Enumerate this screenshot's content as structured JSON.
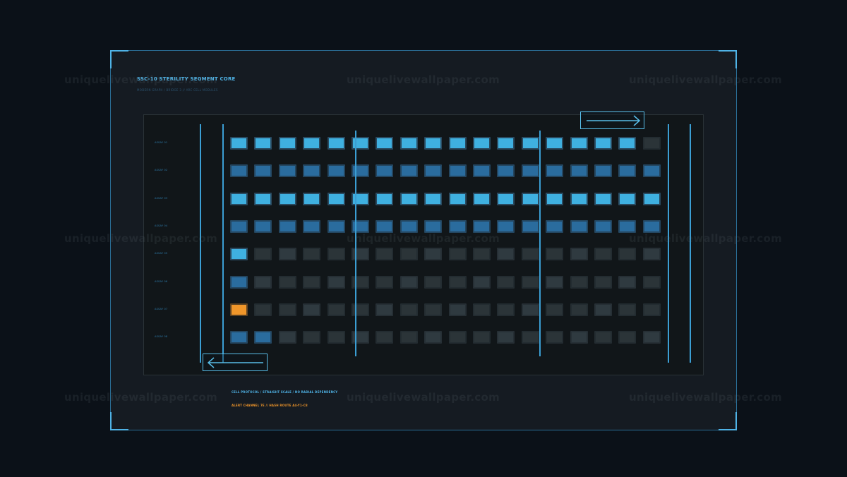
{
  "header": {
    "title": "SSC-10  STERILITY SEGMENT CORE",
    "subtitle": "MODERN GRAPH / BRIDGE 3  //  ARC CELL MODULES"
  },
  "rows": [
    {
      "label": "ASSAY 01",
      "states": [
        "bright",
        "bright",
        "bright",
        "bright",
        "bright",
        "bright",
        "bright",
        "bright",
        "bright",
        "bright",
        "bright",
        "bright",
        "bright",
        "bright",
        "bright",
        "bright",
        "bright",
        "dim"
      ]
    },
    {
      "label": "ASSAY 02",
      "states": [
        "mid",
        "mid",
        "mid",
        "mid",
        "mid",
        "mid",
        "mid",
        "mid",
        "mid",
        "mid",
        "mid",
        "mid",
        "mid",
        "mid",
        "mid",
        "mid",
        "mid",
        "mid"
      ]
    },
    {
      "label": "ASSAY 03",
      "states": [
        "bright",
        "bright",
        "bright",
        "bright",
        "bright",
        "bright",
        "bright",
        "bright",
        "bright",
        "bright",
        "bright",
        "bright",
        "bright",
        "bright",
        "bright",
        "bright",
        "bright",
        "bright"
      ]
    },
    {
      "label": "ASSAY 04",
      "states": [
        "mid",
        "mid",
        "mid",
        "mid",
        "mid",
        "mid",
        "mid",
        "mid",
        "mid",
        "mid",
        "mid",
        "mid",
        "mid",
        "mid",
        "mid",
        "mid",
        "mid",
        "mid"
      ]
    },
    {
      "label": "ASSAY 05",
      "states": [
        "bright",
        "dim",
        "dim2",
        "dim",
        "dim",
        "dim2",
        "dim",
        "dim",
        "dim2",
        "dim",
        "dim",
        "dim2",
        "dim",
        "dim",
        "dim2",
        "dim",
        "dim",
        "dim2"
      ]
    },
    {
      "label": "ASSAY 06",
      "states": [
        "mid",
        "dim2",
        "dim",
        "dim",
        "dim2",
        "dim",
        "dim",
        "dim2",
        "dim",
        "dim",
        "dim2",
        "dim",
        "dim",
        "dim2",
        "dim",
        "dim",
        "dim2",
        "dim"
      ]
    },
    {
      "label": "ASSAY 07",
      "states": [
        "alert",
        "dim",
        "dim",
        "dim2",
        "dim",
        "dim",
        "dim2",
        "dim",
        "dim",
        "dim2",
        "dim",
        "dim",
        "dim2",
        "dim",
        "dim",
        "dim2",
        "dim",
        "dim"
      ]
    },
    {
      "label": "ASSAY 08",
      "states": [
        "mid",
        "mid",
        "dim2",
        "dim",
        "dim",
        "dim2",
        "dim",
        "dim",
        "dim2",
        "dim",
        "dim",
        "dim2",
        "dim",
        "dim",
        "dim2",
        "dim",
        "dim",
        "dim2"
      ]
    }
  ],
  "footer": {
    "line1": "CELL PROTOCOL / STRAIGHT SCALE / NO RADIAL DEPENDENCY",
    "line2": "ALERT CHANNEL 7E  //  HASH ROUTE A4-Y1-C8"
  },
  "watermark": "uniquelivewallpaper.com",
  "colors": {
    "accent": "#4fb3e6",
    "cell_bright": "#3fb0e0",
    "cell_mid": "#2a6c9e",
    "cell_dim": "#2b3438",
    "alert": "#f0962a",
    "background": "#0b1118"
  },
  "icons": {
    "arrow_right": "arrow-right-icon",
    "arrow_left": "arrow-left-icon"
  }
}
